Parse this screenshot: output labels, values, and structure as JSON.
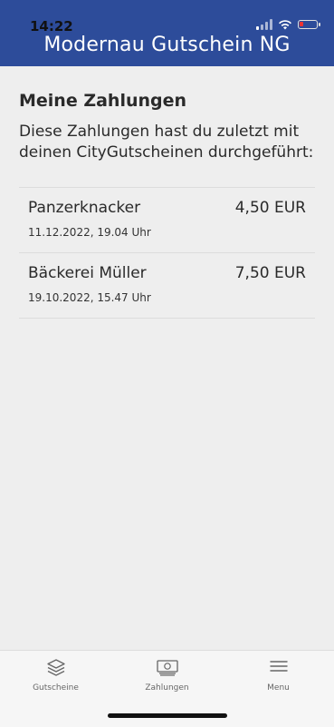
{
  "status": {
    "time": "14:22"
  },
  "header": {
    "title": "Modernau Gutschein NG"
  },
  "main": {
    "title": "Meine Zahlungen",
    "description": "Diese Zahlungen hast du zuletzt mit deinen CityGutscheinen durchgeführt:",
    "payments": [
      {
        "merchant": "Panzerknacker",
        "date": "11.12.2022, 19.04 Uhr",
        "amount": "4,50 EUR"
      },
      {
        "merchant": "Bäckerei Müller",
        "date": "19.10.2022, 15.47 Uhr",
        "amount": "7,50 EUR"
      }
    ]
  },
  "tabbar": {
    "tabs": [
      {
        "label": "Gutscheine",
        "icon": "layers-icon"
      },
      {
        "label": "Zahlungen",
        "icon": "money-icon"
      },
      {
        "label": "Menu",
        "icon": "menu-icon"
      }
    ]
  },
  "colors": {
    "header": "#2d4c9a",
    "background": "#eeeeee",
    "battery_low": "#e33333"
  }
}
